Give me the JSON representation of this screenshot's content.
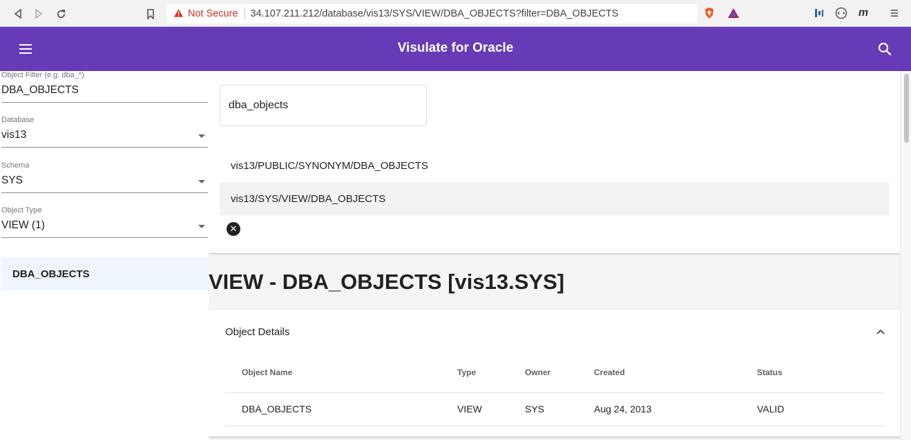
{
  "browser": {
    "security_label": "Not Secure",
    "url": "34.107.211.212/database/vis13/SYS/VIEW/DBA_OBJECTS?filter=DBA_OBJECTS",
    "icons": [
      "back-icon",
      "forward-icon",
      "reload-icon",
      "bookmark-icon",
      "warning-icon",
      "brave-shield-icon",
      "brave-rewards-icon",
      "extension-icon",
      "extension-icon",
      "extension-icon",
      "browser-menu-icon"
    ]
  },
  "appbar": {
    "title": "Visulate for Oracle",
    "color": "#673ab7"
  },
  "sidebar": {
    "filter": {
      "label": "Object Filter (e.g. dba_*)",
      "value": "DBA_OBJECTS"
    },
    "database": {
      "label": "Database",
      "value": "vis13"
    },
    "schema": {
      "label": "Schema",
      "value": "SYS"
    },
    "object_type": {
      "label": "Object Type",
      "value": "VIEW (1)"
    },
    "items": [
      {
        "label": "DBA_OBJECTS"
      }
    ]
  },
  "search": {
    "query": "dba_objects",
    "results": [
      {
        "label": "vis13/PUBLIC/SYNONYM/DBA_OBJECTS"
      },
      {
        "label": "vis13/SYS/VIEW/DBA_OBJECTS"
      }
    ]
  },
  "object": {
    "heading": "VIEW - DBA_OBJECTS [vis13.SYS]"
  },
  "details": {
    "title": "Object Details",
    "columns": [
      "Object Name",
      "Type",
      "Owner",
      "Created",
      "Status"
    ],
    "rows": [
      [
        "DBA_OBJECTS",
        "VIEW",
        "SYS",
        "Aug 24, 2013",
        "VALID"
      ]
    ]
  }
}
